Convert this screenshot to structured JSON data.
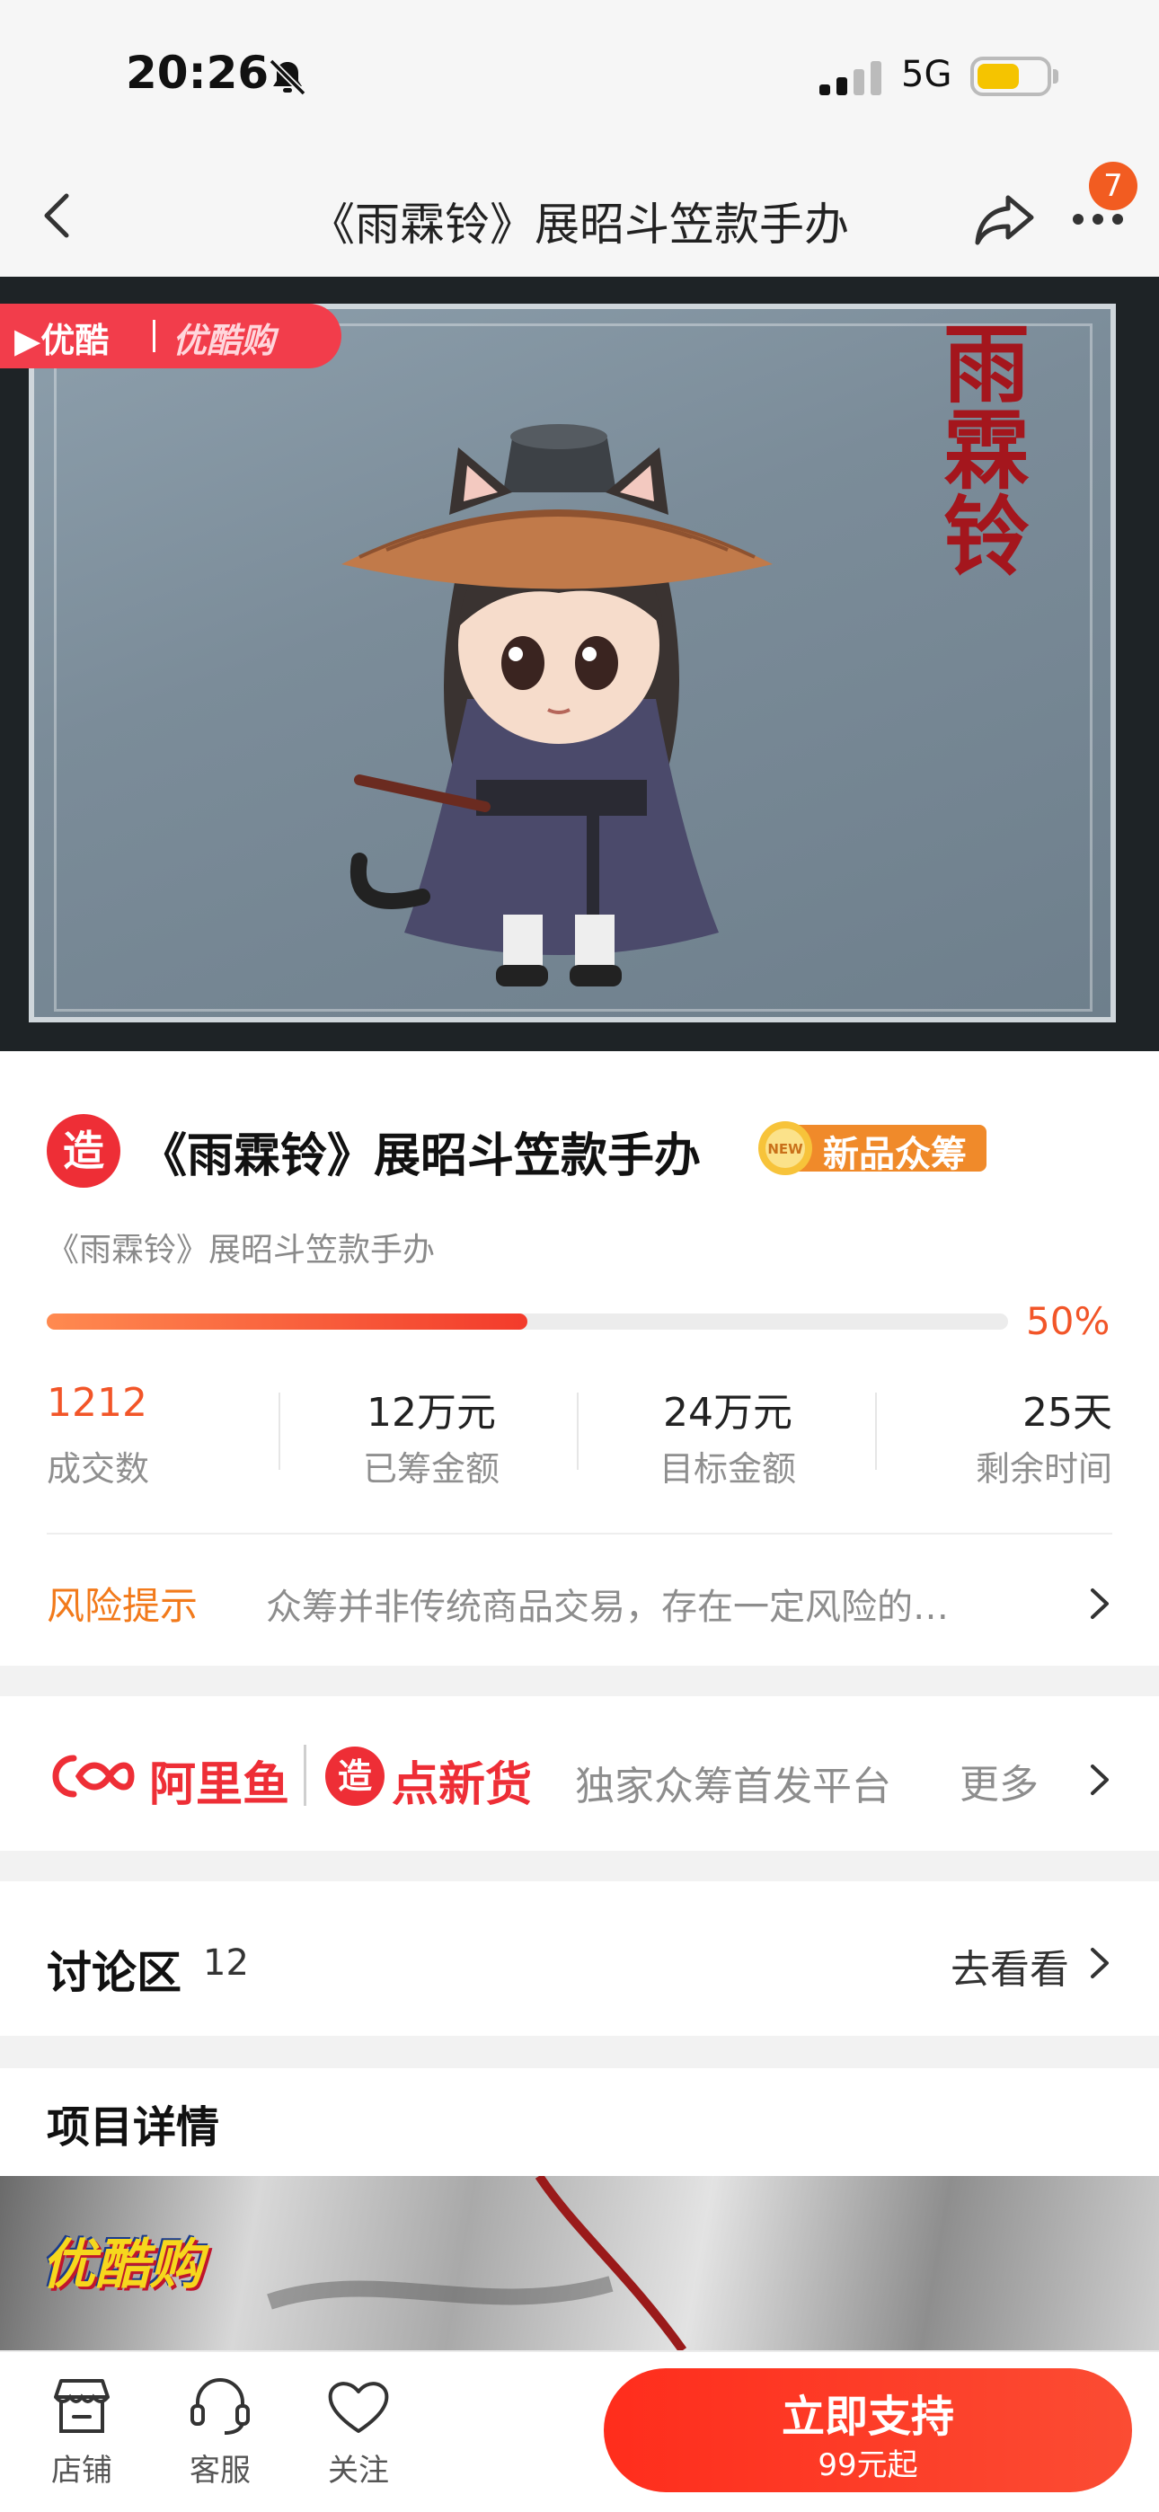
{
  "status_bar": {
    "time": "20:26",
    "network": "5G"
  },
  "nav": {
    "title": "《雨霖铃》展昭斗笠款手办",
    "more_badge": "7"
  },
  "hero": {
    "youku_logo": "▶优酷",
    "youku_goods": "优酷购",
    "drama_logo": "雨霖铃"
  },
  "product": {
    "title": "《雨霖铃》展昭斗笠款手办",
    "badge": "新品众筹",
    "badge_new": "NEW",
    "subtitle": "《雨霖铃》展昭斗笠款手办",
    "progress_pct": "50%",
    "progress_fraction": 0.5,
    "stats": [
      {
        "value": "1212",
        "label": "成交数"
      },
      {
        "value": "12万元",
        "label": "已筹金额"
      },
      {
        "value": "24万元",
        "label": "目标金额"
      },
      {
        "value": "25天",
        "label": "剩余时间"
      }
    ],
    "risk_label": "风险提示",
    "risk_text": "众筹并非传统商品交易，存在一定风险的…"
  },
  "platform": {
    "aliyu": "阿里鱼",
    "zdxh_icon": "造",
    "zdxh": "点新货",
    "desc": "独家众筹首发平台",
    "more": "更多"
  },
  "discussion": {
    "label": "讨论区",
    "count": "12",
    "go": "去看看"
  },
  "details": {
    "title": "项目详情",
    "brand": "优酷购"
  },
  "bottom": {
    "tabs": [
      {
        "label": "店铺",
        "icon": "store-icon"
      },
      {
        "label": "客服",
        "icon": "headset-icon"
      },
      {
        "label": "关注",
        "icon": "heart-icon"
      }
    ],
    "cta_main": "立即支持",
    "cta_sub": "99元起"
  },
  "colors": {
    "accent": "#ee2e36",
    "progress": "#f25528",
    "risk": "#f27a1b"
  }
}
